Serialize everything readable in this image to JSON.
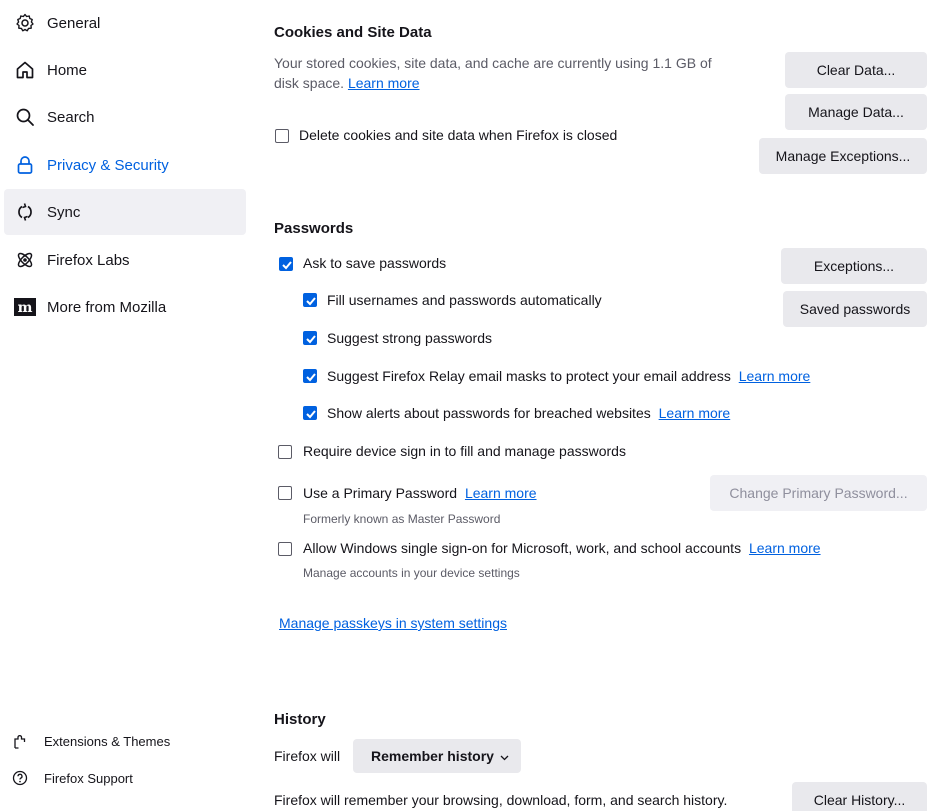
{
  "sidebar": {
    "items": [
      {
        "label": "General",
        "icon": "gear-icon"
      },
      {
        "label": "Home",
        "icon": "home-icon"
      },
      {
        "label": "Search",
        "icon": "search-icon"
      },
      {
        "label": "Privacy & Security",
        "icon": "lock-icon",
        "selected": true
      },
      {
        "label": "Sync",
        "icon": "sync-icon"
      },
      {
        "label": "Firefox Labs",
        "icon": "labs-icon"
      },
      {
        "label": "More from Mozilla",
        "icon": "mozilla-icon"
      }
    ],
    "bottom": [
      {
        "label": "Extensions & Themes",
        "icon": "puzzle-icon"
      },
      {
        "label": "Firefox Support",
        "icon": "help-icon"
      }
    ]
  },
  "cookies": {
    "title": "Cookies and Site Data",
    "desc_line1": "Your stored cookies, site data, and cache are currently using 1.1 GB of",
    "desc_line2": "disk space.",
    "learn_more": "Learn more",
    "clear_data": "Clear Data...",
    "manage_data": "Manage Data...",
    "delete_on_close": "Delete cookies and site data when Firefox is closed",
    "manage_exceptions": "Manage Exceptions..."
  },
  "passwords": {
    "title": "Passwords",
    "ask_to_save": "Ask to save passwords",
    "exceptions": "Exceptions...",
    "fill_auto": "Fill usernames and passwords automatically",
    "saved_passwords": "Saved passwords",
    "suggest_strong": "Suggest strong passwords",
    "suggest_relay": "Suggest Firefox Relay email masks to protect your email address",
    "relay_learn_more": "Learn more",
    "show_alerts": "Show alerts about passwords for breached websites",
    "alerts_learn_more": "Learn more",
    "require_device": "Require device sign in to fill and manage passwords",
    "primary_password": "Use a Primary Password",
    "primary_learn_more": "Learn more",
    "change_primary": "Change Primary Password...",
    "formerly": "Formerly known as Master Password",
    "windows_sso": "Allow Windows single sign-on for Microsoft, work, and school accounts",
    "sso_learn_more": "Learn more",
    "manage_accounts": "Manage accounts in your device settings",
    "manage_passkeys": "Manage passkeys in system settings"
  },
  "history": {
    "title": "History",
    "firefox_will": "Firefox will",
    "mode": "Remember history",
    "description": "Firefox will remember your browsing, download, form, and search history.",
    "clear_history": "Clear History..."
  },
  "colors": {
    "accent": "#0061e0",
    "button_bg": "#e9e9ed",
    "hover_bg": "#f0f0f4"
  }
}
